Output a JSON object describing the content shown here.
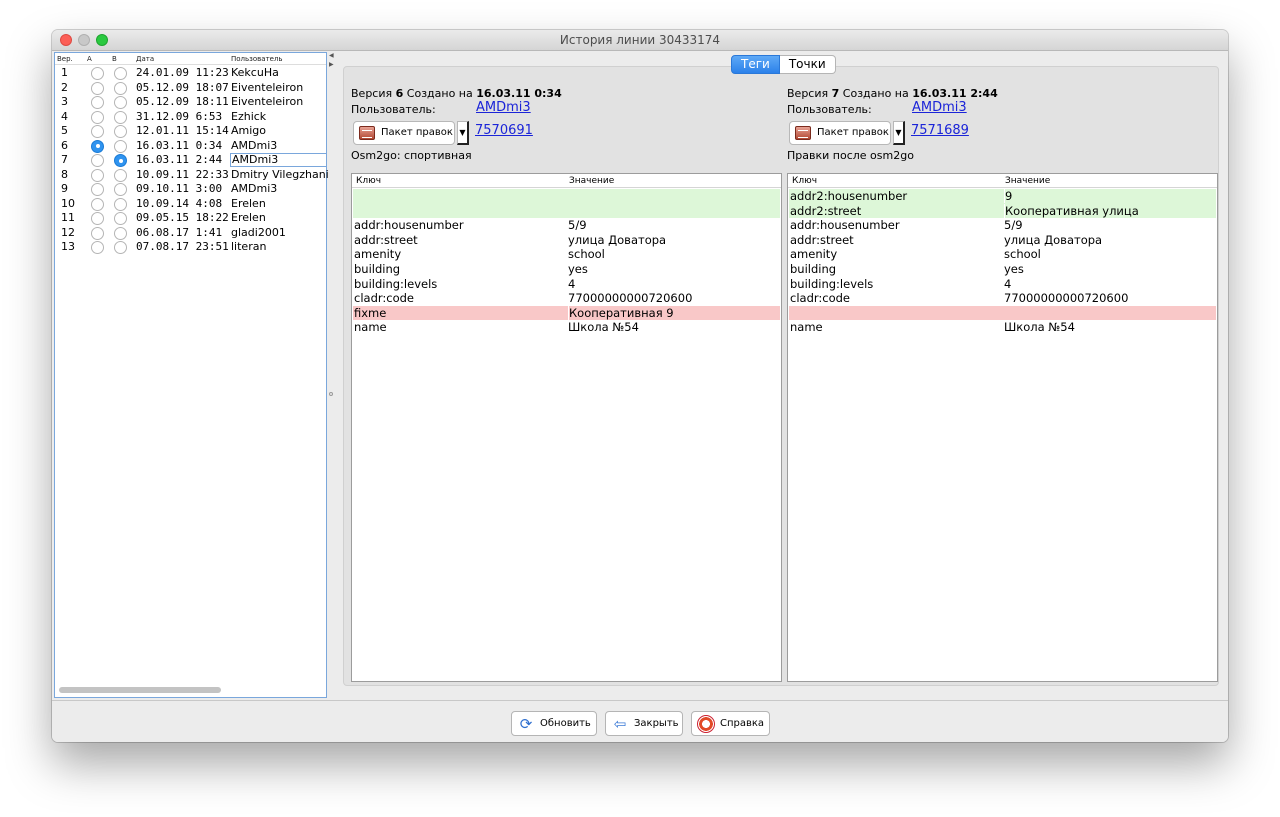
{
  "window": {
    "title": "История линии 30433174"
  },
  "versions": {
    "headers": {
      "ver": "Вер.",
      "a": "А",
      "b": "В",
      "date": "Дата",
      "user": "Пользователь"
    },
    "rows": [
      {
        "num": "1",
        "date": "24.01.09 11:23",
        "user": "KekcuHa",
        "a": false,
        "b": false
      },
      {
        "num": "2",
        "date": "05.12.09 18:07",
        "user": "Eiventeleiron",
        "a": false,
        "b": false
      },
      {
        "num": "3",
        "date": "05.12.09 18:11",
        "user": "Eiventeleiron",
        "a": false,
        "b": false
      },
      {
        "num": "4",
        "date": "31.12.09 6:53",
        "user": "Ezhick",
        "a": false,
        "b": false
      },
      {
        "num": "5",
        "date": "12.01.11 15:14",
        "user": "Amigo",
        "a": false,
        "b": false
      },
      {
        "num": "6",
        "date": "16.03.11 0:34",
        "user": "AMDmi3",
        "a": true,
        "b": false
      },
      {
        "num": "7",
        "date": "16.03.11 2:44",
        "user": "AMDmi3",
        "a": false,
        "b": true
      },
      {
        "num": "8",
        "date": "10.09.11 22:33",
        "user": "Dmitry Vilegzhanin",
        "a": false,
        "b": false
      },
      {
        "num": "9",
        "date": "09.10.11 3:00",
        "user": "AMDmi3",
        "a": false,
        "b": false
      },
      {
        "num": "10",
        "date": "10.09.14 4:08",
        "user": "Erelen",
        "a": false,
        "b": false
      },
      {
        "num": "11",
        "date": "09.05.15 18:22",
        "user": "Erelen",
        "a": false,
        "b": false
      },
      {
        "num": "12",
        "date": "06.08.17 1:41",
        "user": "gladi2001",
        "a": false,
        "b": false
      },
      {
        "num": "13",
        "date": "07.08.17 23:51",
        "user": "literan",
        "a": false,
        "b": false
      }
    ]
  },
  "tabs": {
    "tags": "Теги",
    "points": "Точки"
  },
  "left": {
    "version_label": "Версия",
    "version": "6",
    "created_label": "Создано на",
    "created": "16.03.11 0:34",
    "user_label": "Пользователь:",
    "user": "AMDmi3",
    "changeset_button": "Пакет правок",
    "changeset": "7570691",
    "comment": "Osm2go: спортивная",
    "key_header": "Ключ",
    "value_header": "Значение",
    "rows": [
      {
        "key": "",
        "value": "",
        "state": "add"
      },
      {
        "key": "",
        "value": "",
        "state": "add"
      },
      {
        "key": "addr:housenumber",
        "value": "5/9",
        "state": ""
      },
      {
        "key": "addr:street",
        "value": "улица Доватора",
        "state": ""
      },
      {
        "key": "amenity",
        "value": "school",
        "state": ""
      },
      {
        "key": "building",
        "value": "yes",
        "state": ""
      },
      {
        "key": "building:levels",
        "value": "4",
        "state": ""
      },
      {
        "key": "cladr:code",
        "value": "77000000000720600",
        "state": ""
      },
      {
        "key": "fixme",
        "value": "Кооперативная 9",
        "state": "del"
      },
      {
        "key": "name",
        "value": "Школа №54",
        "state": ""
      }
    ]
  },
  "right": {
    "version_label": "Версия",
    "version": "7",
    "created_label": "Создано на",
    "created": "16.03.11 2:44",
    "user_label": "Пользователь:",
    "user": "AMDmi3",
    "changeset_button": "Пакет правок",
    "changeset": "7571689",
    "comment": "Правки после osm2go",
    "key_header": "Ключ",
    "value_header": "Значение",
    "rows": [
      {
        "key": "addr2:housenumber",
        "value": "9",
        "state": "add"
      },
      {
        "key": "addr2:street",
        "value": "Кооперативная улица",
        "state": "add"
      },
      {
        "key": "addr:housenumber",
        "value": "5/9",
        "state": ""
      },
      {
        "key": "addr:street",
        "value": "улица Доватора",
        "state": ""
      },
      {
        "key": "amenity",
        "value": "school",
        "state": ""
      },
      {
        "key": "building",
        "value": "yes",
        "state": ""
      },
      {
        "key": "building:levels",
        "value": "4",
        "state": ""
      },
      {
        "key": "cladr:code",
        "value": "77000000000720600",
        "state": ""
      },
      {
        "key": "",
        "value": "",
        "state": "del"
      },
      {
        "key": "name",
        "value": "Школа №54",
        "state": ""
      }
    ]
  },
  "buttons": {
    "refresh": "Обновить",
    "close": "Закрыть",
    "help": "Справка"
  },
  "icons": {
    "refresh": "refresh-icon",
    "close": "close-arrow-icon",
    "help": "lifebuoy-icon",
    "changeset": "package-icon"
  },
  "colors": {
    "added_row": "#ddf7d8",
    "removed_row": "#f9c8c8",
    "accent": "#2b81ea",
    "link": "#1b24d8"
  }
}
